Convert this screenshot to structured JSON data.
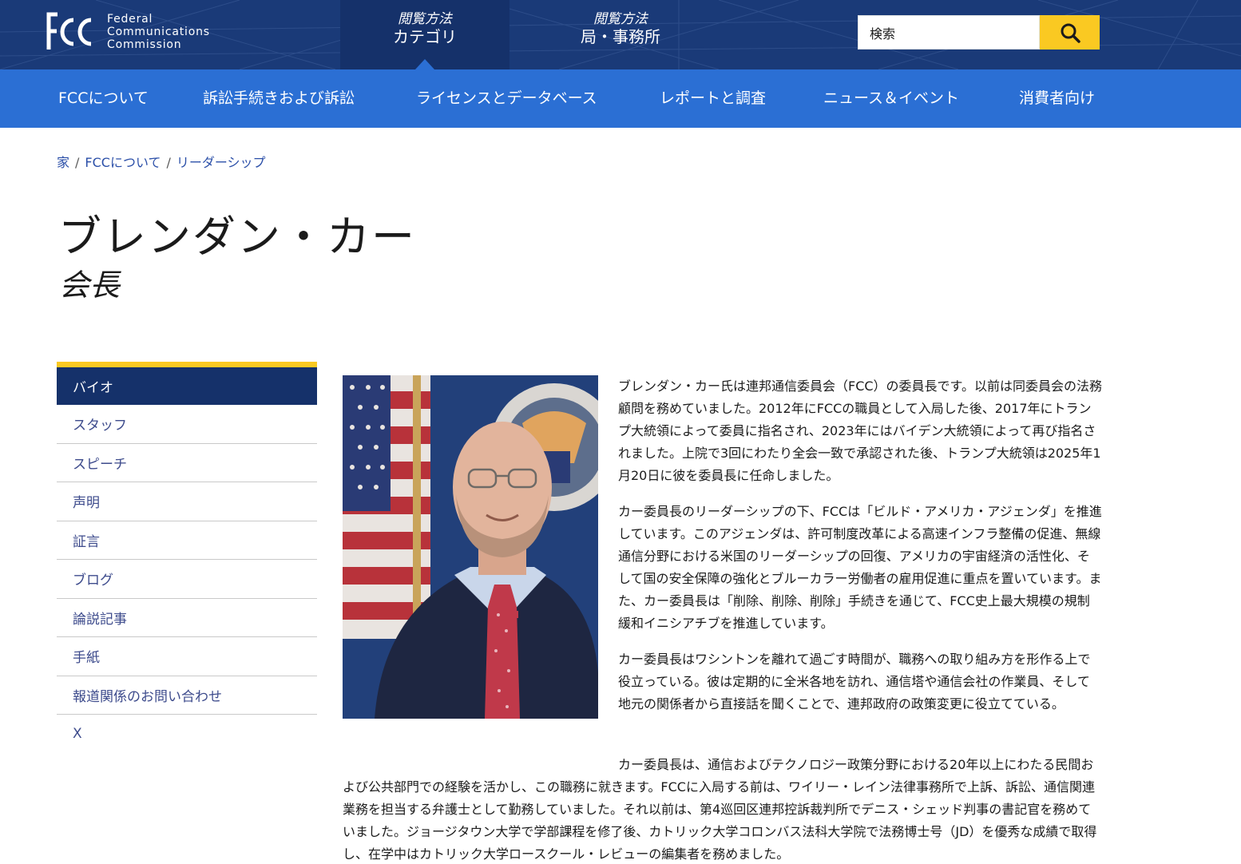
{
  "header": {
    "logo_text": [
      "Federal",
      "Communications",
      "Commission"
    ],
    "browse": [
      {
        "label_small": "閲覧方法",
        "label_large": "カテゴリ"
      },
      {
        "label_small": "閲覧方法",
        "label_large": "局・事務所"
      }
    ],
    "search_placeholder": "検索"
  },
  "main_nav": [
    "FCCについて",
    "訴訟手続きおよび訴訟",
    "ライセンスとデータベース",
    "レポートと調査",
    "ニュース＆イベント",
    "消費者向け"
  ],
  "breadcrumb": [
    "家",
    "FCCについて",
    "リーダーシップ"
  ],
  "page": {
    "title": "ブレンダン・カー",
    "subtitle": "会長"
  },
  "sidenav": [
    "バイオ",
    "スタッフ",
    "スピーチ",
    "声明",
    "証言",
    "ブログ",
    "論説記事",
    "手紙",
    "報道関係のお問い合わせ",
    "X"
  ],
  "bio": {
    "p1": "ブレンダン・カー氏は連邦通信委員会（FCC）の委員長です。以前は同委員会の法務顧問を務めていました。2012年にFCCの職員として入局した後、2017年にトランプ大統領によって委員に指名され、2023年にはバイデン大統領によって再び指名されました。上院で3回にわたり全会一致で承認された後、トランプ大統領は2025年1月20日に彼を委員長に任命しました。",
    "p2": "カー委員長のリーダーシップの下、FCCは「ビルド・アメリカ・アジェンダ」を推進しています。このアジェンダは、許可制度改革による高速インフラ整備の促進、無線通信分野における米国のリーダーシップの回復、アメリカの宇宙経済の活性化、そして国の安全保障の強化とブルーカラー労働者の雇用促進に重点を置いています。また、カー委員長は「削除、削除、削除」手続きを通じて、FCC史上最大規模の規制緩和イニシアチブを推進しています。",
    "p3": "カー委員長はワシントンを離れて過ごす時間が、職務への取り組み方を形作る上で役立っている。彼は定期的に全米各地を訪れ、通信塔や通信会社の作業員、そして地元の関係者から直接話を聞くことで、連邦政府の政策変更に役立てている。",
    "p4": "カー委員長は、通信およびテクノロジー政策分野における20年以上にわたる民間および公共部門での経験を活かし、この職務に就きます。FCCに入局する前は、ワイリー・レイン法律事務所で上訴、訴訟、通信関連業務を担当する弁護士として勤務していました。それ以前は、第4巡回区連邦控訴裁判所でデニス・シェッド判事の書記官を務めていました。ジョージタウン大学で学部課程を修了後、カトリック大学コロンバス法科大学院で法務博士号（JD）を優秀な成績で取得し、在学中はカトリック大学ロースクール・レビューの編集者を務めました。"
  },
  "colors": {
    "topbar": "#1a3a78",
    "nav": "#2b6fd4",
    "accent": "#fac922",
    "sidenav_active": "#15316a"
  }
}
